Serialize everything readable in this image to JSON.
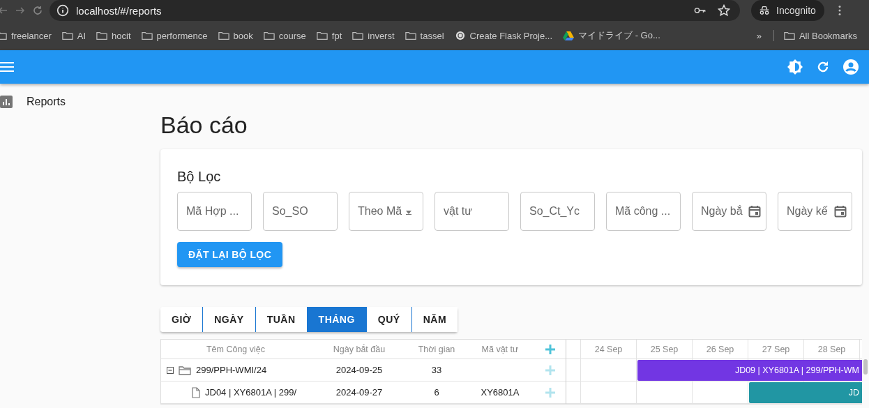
{
  "browser": {
    "url": "localhost/#/reports",
    "incognito_label": "Incognito",
    "bookmarks": [
      {
        "label": "freelancer",
        "kind": "folder"
      },
      {
        "label": "AI",
        "kind": "folder"
      },
      {
        "label": "hocit",
        "kind": "folder"
      },
      {
        "label": "performence",
        "kind": "folder"
      },
      {
        "label": "book",
        "kind": "folder"
      },
      {
        "label": "course",
        "kind": "folder"
      },
      {
        "label": "fpt",
        "kind": "folder"
      },
      {
        "label": "inverst",
        "kind": "folder"
      },
      {
        "label": "tassel",
        "kind": "folder"
      },
      {
        "label": "Create Flask Proje...",
        "kind": "site"
      },
      {
        "label": "マイドライブ - Go...",
        "kind": "drive"
      }
    ],
    "more": "»",
    "all_bookmarks": "All Bookmarks"
  },
  "sidebar": {
    "items": [
      {
        "label": "Reports",
        "selected": false
      }
    ]
  },
  "page_title": "Báo cáo",
  "filter": {
    "title": "Bộ Lọc",
    "fields": [
      {
        "placeholder": "Mã Hợp ...",
        "kind": "text"
      },
      {
        "placeholder": "So_SO",
        "kind": "text"
      },
      {
        "placeholder": "Theo Mã",
        "kind": "select"
      },
      {
        "placeholder": "vật tư",
        "kind": "text"
      },
      {
        "placeholder": "So_Ct_Yc",
        "kind": "text"
      },
      {
        "placeholder": "Mã công ...",
        "kind": "text"
      },
      {
        "placeholder": "Ngày bắ",
        "kind": "date"
      },
      {
        "placeholder": "Ngày kế",
        "kind": "date"
      }
    ],
    "reset_button": "ĐẶT LẠI BỘ LỌC"
  },
  "scale_tabs": [
    {
      "label": "GIỜ",
      "selected": false
    },
    {
      "label": "NGÀY",
      "selected": false
    },
    {
      "label": "TUẦN",
      "selected": false
    },
    {
      "label": "THÁNG",
      "selected": true
    },
    {
      "label": "QUÝ",
      "selected": false
    },
    {
      "label": "NĂM",
      "selected": false
    }
  ],
  "gantt": {
    "columns": [
      "Têm Công việc",
      "Ngày bắt đầu",
      "Thời gian",
      "Mã vật tư"
    ],
    "timeline": [
      "24 Sep",
      "25 Sep",
      "26 Sep",
      "27 Sep",
      "28 Sep"
    ],
    "rows": [
      {
        "name": "299/PPH-WMI/24",
        "start": "2024-09-25",
        "duration": "33",
        "material": "",
        "kind": "folder",
        "expanded": true,
        "bar": {
          "label": "JD09 | XY6801A | 299/PPH-WM",
          "color": "#7236e3"
        },
        "children": [
          {
            "name": "JD04 | XY6801A | 299/",
            "start": "2024-09-27",
            "duration": "6",
            "material": "XY6801A",
            "kind": "file",
            "bar": {
              "label": "JD",
              "color": "#2196a3"
            }
          }
        ]
      }
    ]
  }
}
